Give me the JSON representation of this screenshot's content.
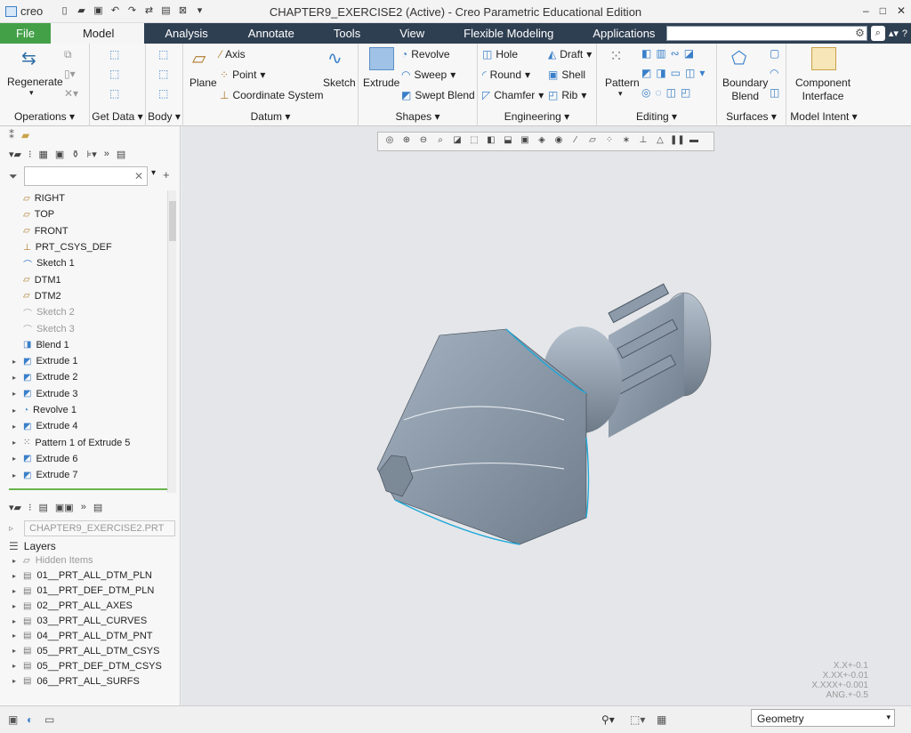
{
  "app": {
    "logo": "creo",
    "window_title": "CHAPTER9_EXERCISE2 (Active) - Creo Parametric Educational Edition"
  },
  "tabs": [
    {
      "label": "File"
    },
    {
      "label": "Model"
    },
    {
      "label": "Analysis"
    },
    {
      "label": "Annotate"
    },
    {
      "label": "Tools"
    },
    {
      "label": "View"
    },
    {
      "label": "Flexible Modeling"
    },
    {
      "label": "Applications"
    }
  ],
  "ribbon": {
    "operations": {
      "regenerate": "Regenerate",
      "label": "Operations"
    },
    "getdata": {
      "label": "Get Data"
    },
    "body": {
      "label": "Body"
    },
    "datum": {
      "plane": "Plane",
      "axis": "Axis",
      "point": "Point",
      "csys": "Coordinate System",
      "sketch": "Sketch",
      "label": "Datum"
    },
    "shapes": {
      "extrude": "Extrude",
      "revolve": "Revolve",
      "sweep": "Sweep",
      "swept_blend": "Swept Blend",
      "label": "Shapes"
    },
    "engineering": {
      "hole": "Hole",
      "round": "Round",
      "chamfer": "Chamfer",
      "draft": "Draft",
      "shell": "Shell",
      "rib": "Rib",
      "label": "Engineering"
    },
    "editing": {
      "pattern": "Pattern",
      "label": "Editing"
    },
    "surfaces": {
      "boundary": "Boundary",
      "blend": "Blend",
      "label": "Surfaces"
    },
    "intent": {
      "component": "Component",
      "interface": "Interface",
      "label": "Model Intent"
    }
  },
  "tree": [
    {
      "label": "RIGHT",
      "icon": "datum-plane-icon",
      "expandable": false,
      "dim": false
    },
    {
      "label": "TOP",
      "icon": "datum-plane-icon",
      "expandable": false,
      "dim": false
    },
    {
      "label": "FRONT",
      "icon": "datum-plane-icon",
      "expandable": false,
      "dim": false
    },
    {
      "label": "PRT_CSYS_DEF",
      "icon": "csys-icon",
      "expandable": false,
      "dim": false
    },
    {
      "label": "Sketch 1",
      "icon": "sketch-icon",
      "expandable": false,
      "dim": false
    },
    {
      "label": "DTM1",
      "icon": "datum-plane-icon",
      "expandable": false,
      "dim": false
    },
    {
      "label": "DTM2",
      "icon": "datum-plane-icon",
      "expandable": false,
      "dim": false
    },
    {
      "label": "Sketch 2",
      "icon": "sketch-icon",
      "expandable": false,
      "dim": true
    },
    {
      "label": "Sketch 3",
      "icon": "sketch-icon",
      "expandable": false,
      "dim": true
    },
    {
      "label": "Blend 1",
      "icon": "blend-icon",
      "expandable": false,
      "dim": false
    },
    {
      "label": "Extrude 1",
      "icon": "extrude-icon",
      "expandable": true,
      "dim": false
    },
    {
      "label": "Extrude 2",
      "icon": "extrude-icon",
      "expandable": true,
      "dim": false
    },
    {
      "label": "Extrude 3",
      "icon": "extrude-icon",
      "expandable": true,
      "dim": false
    },
    {
      "label": "Revolve 1",
      "icon": "revolve-icon",
      "expandable": true,
      "dim": false
    },
    {
      "label": "Extrude 4",
      "icon": "extrude-icon",
      "expandable": true,
      "dim": false
    },
    {
      "label": "Pattern 1 of Extrude 5",
      "icon": "pattern-icon",
      "expandable": true,
      "dim": false
    },
    {
      "label": "Extrude 6",
      "icon": "extrude-icon",
      "expandable": true,
      "dim": false
    },
    {
      "label": "Extrude 7",
      "icon": "extrude-icon",
      "expandable": true,
      "dim": false
    }
  ],
  "layers": {
    "part": "CHAPTER9_EXERCISE2.PRT",
    "title": "Layers",
    "items": [
      {
        "label": "Hidden Items",
        "dim": true
      },
      {
        "label": "01__PRT_ALL_DTM_PLN",
        "dim": false
      },
      {
        "label": "01__PRT_DEF_DTM_PLN",
        "dim": false
      },
      {
        "label": "02__PRT_ALL_AXES",
        "dim": false
      },
      {
        "label": "03__PRT_ALL_CURVES",
        "dim": false
      },
      {
        "label": "04__PRT_ALL_DTM_PNT",
        "dim": false
      },
      {
        "label": "05__PRT_ALL_DTM_CSYS",
        "dim": false
      },
      {
        "label": "05__PRT_DEF_DTM_CSYS",
        "dim": false
      },
      {
        "label": "06__PRT_ALL_SURFS",
        "dim": false
      }
    ]
  },
  "tolerance": {
    "l1": "X.X+-0.1",
    "l2": "X.XX+-0.01",
    "l3": "X.XXX+-0.001",
    "l4": "ANG.+-0.5"
  },
  "status": {
    "filter": "Geometry"
  },
  "colors": {
    "file_tab": "#43a047",
    "tab_bar": "#2f3f52",
    "model_gray": "#8a98a8",
    "edge_highlight": "#1fa8d8"
  }
}
